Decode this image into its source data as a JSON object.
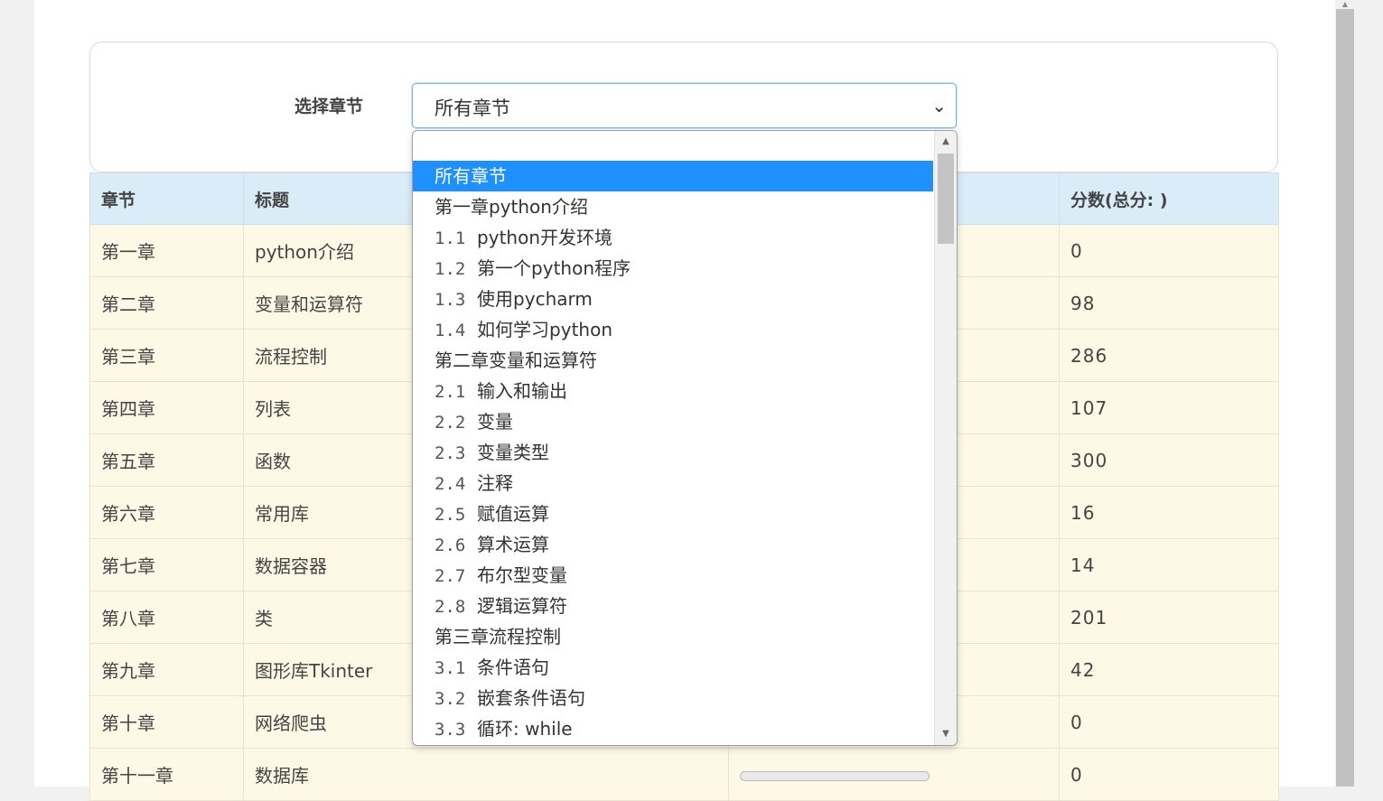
{
  "filter": {
    "label": "选择章节",
    "selected": "所有章节",
    "options": [
      {
        "num": "",
        "text": "所有章节"
      },
      {
        "num": "",
        "text": "第一章python介绍"
      },
      {
        "num": "1.1",
        "text": "python开发环境"
      },
      {
        "num": "1.2",
        "text": "第一个python程序"
      },
      {
        "num": "1.3",
        "text": "使用pycharm"
      },
      {
        "num": "1.4",
        "text": "如何学习python"
      },
      {
        "num": "",
        "text": "第二章变量和运算符"
      },
      {
        "num": "2.1",
        "text": "输入和输出"
      },
      {
        "num": "2.2",
        "text": "变量"
      },
      {
        "num": "2.3",
        "text": "变量类型"
      },
      {
        "num": "2.4",
        "text": "注释"
      },
      {
        "num": "2.5",
        "text": "赋值运算"
      },
      {
        "num": "2.6",
        "text": "算术运算"
      },
      {
        "num": "2.7",
        "text": "布尔型变量"
      },
      {
        "num": "2.8",
        "text": "逻辑运算符"
      },
      {
        "num": "",
        "text": "第三章流程控制"
      },
      {
        "num": "3.1",
        "text": "条件语句"
      },
      {
        "num": "3.2",
        "text": "嵌套条件语句"
      },
      {
        "num": "3.3",
        "text": "循环: while"
      }
    ]
  },
  "table": {
    "headers": {
      "chapter": "章节",
      "title": "标题",
      "progress": "",
      "score": "分数(总分: )"
    },
    "rows": [
      {
        "chapter": "第一章",
        "title": "python介绍",
        "score": "0"
      },
      {
        "chapter": "第二章",
        "title": "变量和运算符",
        "score": "98"
      },
      {
        "chapter": "第三章",
        "title": "流程控制",
        "score": "286"
      },
      {
        "chapter": "第四章",
        "title": "列表",
        "score": "107"
      },
      {
        "chapter": "第五章",
        "title": "函数",
        "score": "300"
      },
      {
        "chapter": "第六章",
        "title": "常用库",
        "score": "16"
      },
      {
        "chapter": "第七章",
        "title": "数据容器",
        "score": "14"
      },
      {
        "chapter": "第八章",
        "title": "类",
        "score": "201"
      },
      {
        "chapter": "第九章",
        "title": "图形库Tkinter",
        "score": "42"
      },
      {
        "chapter": "第十章",
        "title": "网络爬虫",
        "score": "0"
      },
      {
        "chapter": "第十一章",
        "title": "数据库",
        "score": "0",
        "progress": 0
      }
    ]
  },
  "colors": {
    "header_bg": "#d9ecf8",
    "row_bg": "#fdf9e6",
    "link": "#3173b7",
    "selected_option": "#1e90ff"
  }
}
